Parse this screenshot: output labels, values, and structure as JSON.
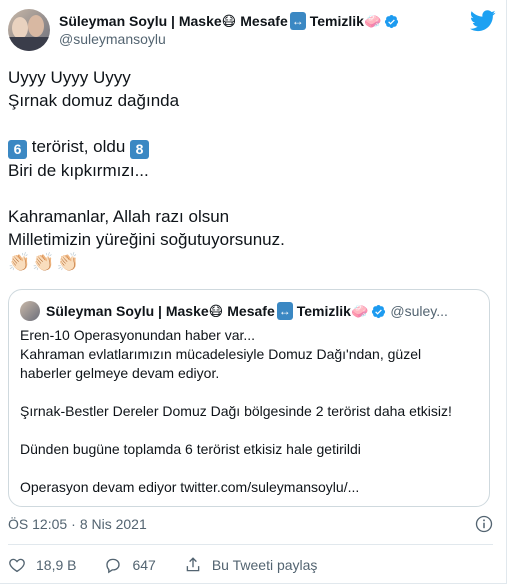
{
  "author": {
    "name": "Süleyman Soylu | Maske",
    "name_mid": "Mesafe",
    "name_end": "Temizlik",
    "handle": "@suleymansoylu",
    "emoji_mask": "😷",
    "emoji_arrows": "↔",
    "emoji_soap": "🧼"
  },
  "tweet": {
    "line1": "Uyyy Uyyy Uyyy",
    "line2": "Şırnak domuz dağında",
    "num_6": "6",
    "line3_text": "terörist, oldu",
    "num_8": "8",
    "line4": "Biri de kıpkırmızı...",
    "line5": "Kahramanlar, Allah razı olsun",
    "line6": "Milletimizin yüreğini soğutuyorsunuz.",
    "claps": "👏🏻👏🏻👏🏻"
  },
  "quoted": {
    "name": "Süleyman Soylu | Maske",
    "name_mid": "Mesafe",
    "name_end": "Temizlik",
    "handle": "@suley...",
    "p1": "Eren-10 Operasyonundan haber var...",
    "p2": "Kahraman evlatlarımızın mücadelesiyle Domuz Dağı'ndan, güzel",
    "p3": "haberler gelmeye devam ediyor.",
    "p4": "Şırnak-Bestler Dereler Domuz Dağı bölgesinde 2 terörist daha etkisiz!",
    "p5": "Dünden bugüne toplamda 6 terörist etkisiz hale getirildi",
    "p6": "Operasyon devam ediyor twitter.com/suleymansoylu/..."
  },
  "meta": {
    "time": "ÖS 12:05",
    "sep": "·",
    "date": "8 Nis 2021"
  },
  "actions": {
    "likes": "18,9 B",
    "replies": "647",
    "share": "Bu Tweeti paylaş"
  },
  "colors": {
    "verified": "#1d9bf0",
    "twitter": "#1da1f2",
    "like": "#536471"
  }
}
